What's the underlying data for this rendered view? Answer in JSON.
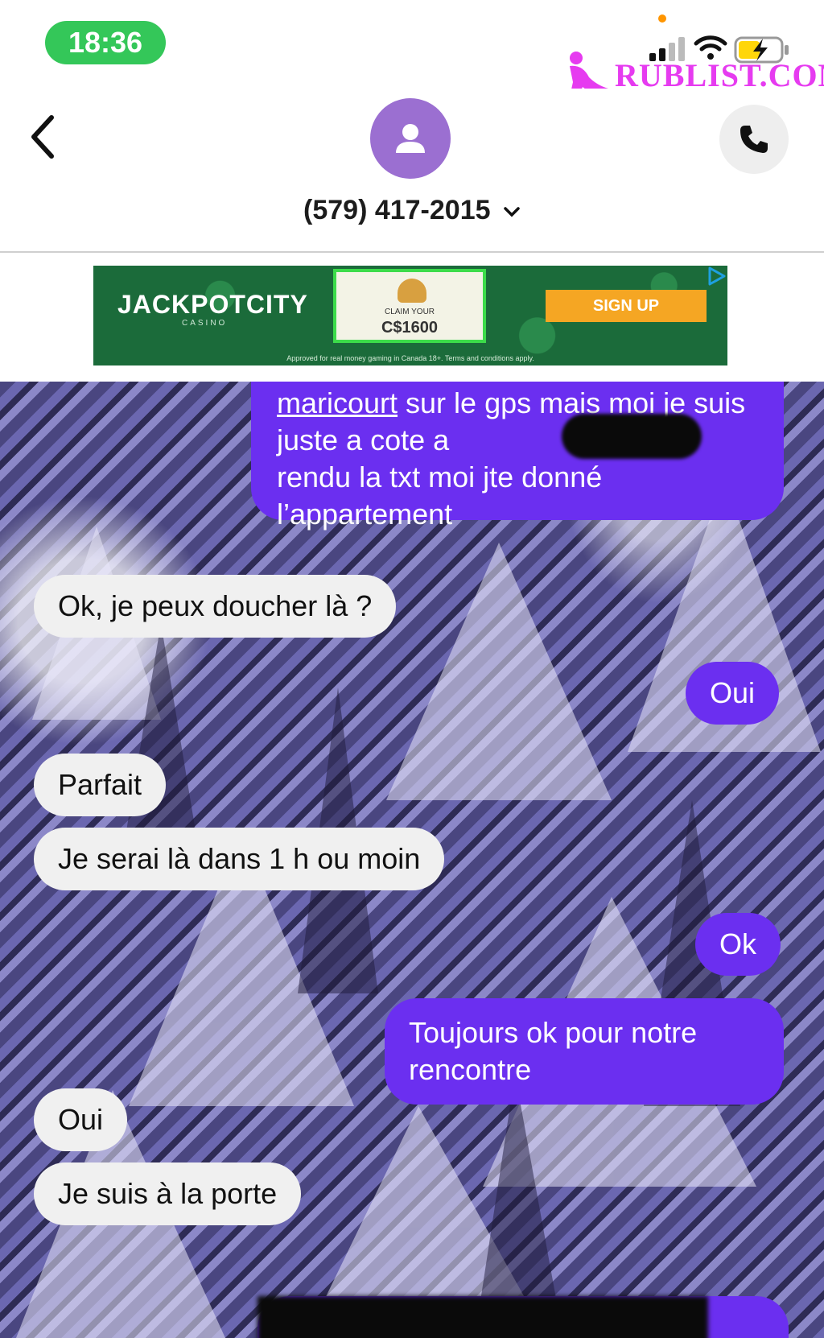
{
  "status_bar": {
    "time": "18:36"
  },
  "watermark": {
    "text": "RUBLIST.COM"
  },
  "header": {
    "contact": "(579) 417-2015"
  },
  "ad": {
    "brand": "JACKPOTCITY",
    "brand_sub": "CASINO",
    "card_line1": "CLAIM YOUR",
    "card_line2": "C$1600",
    "cta": "SIGN UP",
    "legal": "Approved for real money gaming in Canada 18+. Terms and conditions apply."
  },
  "messages": [
    {
      "direction": "sent",
      "link": "maricourt",
      "text_rest": " sur le gps mais moi je suis juste a cote a",
      "text_after": "rendu la txt moi jte donné l’appartement"
    },
    {
      "direction": "received",
      "text": "Ok, je peux doucher là ?"
    },
    {
      "direction": "sent",
      "text": "Oui"
    },
    {
      "direction": "received",
      "text": "Parfait"
    },
    {
      "direction": "received",
      "text": "Je serai là dans 1 h ou moin"
    },
    {
      "direction": "sent",
      "text": "Ok"
    },
    {
      "direction": "sent",
      "text": "Toujours ok pour notre rencontre"
    },
    {
      "direction": "received",
      "text": "Oui"
    },
    {
      "direction": "received",
      "text": "Je suis à la porte"
    }
  ],
  "colors": {
    "sent_bubble": "#6b2ff0",
    "received_bubble": "#f0f0f0",
    "time_pill": "#34c759",
    "avatar": "#9b6fd1",
    "watermark": "#e63bf0"
  },
  "icons": [
    "back-chevron-icon",
    "contact-avatar-icon",
    "phone-icon",
    "chevron-down-icon",
    "signal-icon",
    "wifi-icon",
    "battery-charging-icon",
    "ad-choices-icon"
  ]
}
